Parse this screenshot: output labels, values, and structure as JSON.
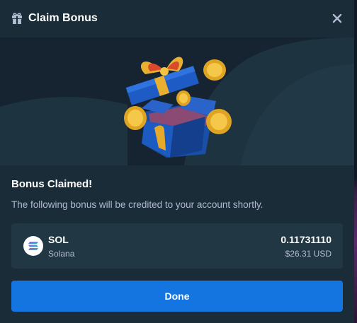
{
  "header": {
    "title": "Claim Bonus",
    "icon": "gift-icon",
    "close_icon": "close-icon"
  },
  "banner": {
    "illustration": "open-gift-box-with-coins"
  },
  "result": {
    "title": "Bonus Claimed!",
    "description": "The following bonus will be credited to your account shortly."
  },
  "bonus": {
    "symbol": "SOL",
    "name": "Solana",
    "amount": "0.11731110",
    "usd_value": "$26.31 USD",
    "icon": "solana-icon"
  },
  "actions": {
    "done_label": "Done"
  },
  "colors": {
    "modal_bg": "#1a2c38",
    "banner_bg": "#152430",
    "row_bg": "#213743",
    "primary": "#1475e1",
    "text_primary": "#ffffff",
    "text_secondary": "#b1bad3"
  }
}
